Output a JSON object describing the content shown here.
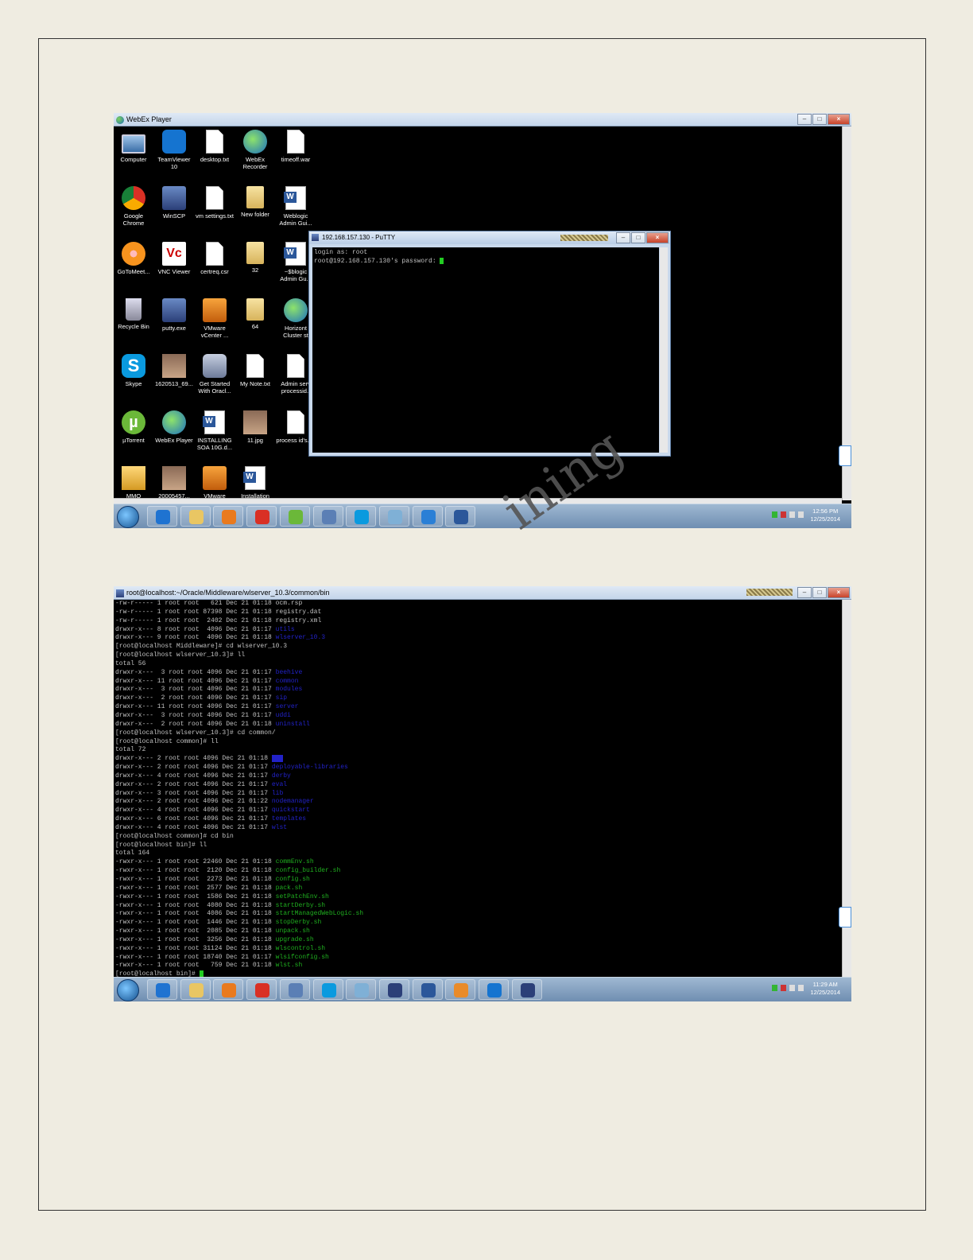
{
  "watermark": "ining",
  "shot1": {
    "window_title": "WebEx Player",
    "desktop_icons": [
      {
        "label": "Computer",
        "icon": "computer-icon",
        "cls": "g-computer"
      },
      {
        "label": "TeamViewer 10",
        "icon": "teamviewer-icon",
        "cls": "g-tv"
      },
      {
        "label": "desktop.txt",
        "icon": "text-file-icon",
        "cls": "g-file"
      },
      {
        "label": "WebEx Recorder",
        "icon": "webex-recorder-icon",
        "cls": "g-webex"
      },
      {
        "label": "timeoff.war",
        "icon": "file-icon",
        "cls": "g-file"
      },
      {
        "label": "Google Chrome",
        "icon": "chrome-icon",
        "cls": "g-chrome"
      },
      {
        "label": "WinSCP",
        "icon": "winscp-icon",
        "cls": "g-putty"
      },
      {
        "label": "vm settings.txt",
        "icon": "text-file-icon",
        "cls": "g-file"
      },
      {
        "label": "New folder",
        "icon": "folder-icon",
        "cls": "g-folder"
      },
      {
        "label": "Weblogic Admin Gui...",
        "icon": "word-doc-icon",
        "cls": "g-word"
      },
      {
        "label": "GoToMeet...",
        "icon": "gotomeeting-icon",
        "cls": "g-gotomeet"
      },
      {
        "label": "VNC Viewer",
        "icon": "vnc-viewer-icon",
        "cls": "g-vnc"
      },
      {
        "label": "certreq.csr",
        "icon": "file-icon",
        "cls": "g-file"
      },
      {
        "label": "32",
        "icon": "folder-icon",
        "cls": "g-folder"
      },
      {
        "label": "~$blogic Admin Gu...",
        "icon": "word-doc-icon",
        "cls": "g-word"
      },
      {
        "label": "Recycle Bin",
        "icon": "recycle-bin-icon",
        "cls": "g-bin"
      },
      {
        "label": "putty.exe",
        "icon": "putty-icon",
        "cls": "g-putty"
      },
      {
        "label": "VMware vCenter ...",
        "icon": "vmware-icon",
        "cls": "g-vmw"
      },
      {
        "label": "64",
        "icon": "folder-icon",
        "cls": "g-folder"
      },
      {
        "label": "Horizont Cluster st",
        "icon": "webex-icon",
        "cls": "g-webex"
      },
      {
        "label": "Skype",
        "icon": "skype-icon",
        "cls": "g-skype"
      },
      {
        "label": "1620513_69...",
        "icon": "photo-icon",
        "cls": "g-photo"
      },
      {
        "label": "Get Started With Oracl...",
        "icon": "database-icon",
        "cls": "g-db"
      },
      {
        "label": "My Note.txt",
        "icon": "text-file-icon",
        "cls": "g-file"
      },
      {
        "label": "Admin serv processid.t",
        "icon": "text-file-icon",
        "cls": "g-file"
      },
      {
        "label": "µTorrent",
        "icon": "utorrent-icon",
        "cls": "g-utorrent"
      },
      {
        "label": "WebEx Player",
        "icon": "webex-player-icon",
        "cls": "g-webex"
      },
      {
        "label": "INSTALLING SOA 10G.d...",
        "icon": "word-doc-icon",
        "cls": "g-word"
      },
      {
        "label": "11.jpg",
        "icon": "photo-icon",
        "cls": "g-photo"
      },
      {
        "label": "process id's.txt",
        "icon": "text-file-icon",
        "cls": "g-file"
      },
      {
        "label": "MMO",
        "icon": "package-icon",
        "cls": "g-pkg"
      },
      {
        "label": "20005457...",
        "icon": "photo-icon",
        "cls": "g-photo"
      },
      {
        "label": "VMware",
        "icon": "vmware-icon",
        "cls": "g-vmw"
      },
      {
        "label": "Installation",
        "icon": "word-doc-icon",
        "cls": "g-word"
      }
    ],
    "putty": {
      "title": "192.168.157.130 - PuTTY",
      "line1": "login as: root",
      "line2": "root@192.168.157.130's password: "
    },
    "clock_time": "12:56 PM",
    "clock_date": "12/25/2014"
  },
  "shot2": {
    "window_title": "root@localhost:~/Oracle/Middleware/wlserver_10.3/common/bin",
    "terminal_lines": [
      {
        "t": "-rw-r----- 1 root root   621 Dec 21 01:18 ocm.rsp"
      },
      {
        "t": "-rw-r----- 1 root root 87398 Dec 21 01:18 registry.dat"
      },
      {
        "t": "-rw-r----- 1 root root  2402 Dec 21 01:18 registry.xml"
      },
      {
        "t": "drwxr-x--- 8 root root  4096 Dec 21 01:17 ",
        "c": "utils",
        "cc": "b"
      },
      {
        "t": "drwxr-x--- 9 root root  4096 Dec 21 01:18 ",
        "c": "wlserver_10.3",
        "cc": "b"
      },
      {
        "t": "[root@localhost Middleware]# cd wlserver_10.3"
      },
      {
        "t": "[root@localhost wlserver_10.3]# ll"
      },
      {
        "t": "total 56"
      },
      {
        "t": "drwxr-x---  3 root root 4096 Dec 21 01:17 ",
        "c": "beehive",
        "cc": "b"
      },
      {
        "t": "drwxr-x--- 11 root root 4096 Dec 21 01:17 ",
        "c": "common",
        "cc": "b"
      },
      {
        "t": "drwxr-x---  3 root root 4096 Dec 21 01:17 ",
        "c": "modules",
        "cc": "b"
      },
      {
        "t": "drwxr-x---  2 root root 4096 Dec 21 01:17 ",
        "c": "sip",
        "cc": "b"
      },
      {
        "t": "drwxr-x--- 11 root root 4096 Dec 21 01:17 ",
        "c": "server",
        "cc": "b"
      },
      {
        "t": "drwxr-x---  3 root root 4096 Dec 21 01:17 ",
        "c": "uddi",
        "cc": "b"
      },
      {
        "t": "drwxr-x---  2 root root 4096 Dec 21 01:18 ",
        "c": "uninstall",
        "cc": "b"
      },
      {
        "t": "[root@localhost wlserver_10.3]# cd common/"
      },
      {
        "t": "[root@localhost common]# ll"
      },
      {
        "t": "total 72"
      },
      {
        "t": "drwxr-x--- 2 root root 4096 Dec 21 01:18 ",
        "c": "bin",
        "cc": "hl"
      },
      {
        "t": "drwxr-x--- 2 root root 4096 Dec 21 01:17 ",
        "c": "deployable-libraries",
        "cc": "b"
      },
      {
        "t": "drwxr-x--- 4 root root 4096 Dec 21 01:17 ",
        "c": "derby",
        "cc": "b"
      },
      {
        "t": "drwxr-x--- 2 root root 4096 Dec 21 01:17 ",
        "c": "eval",
        "cc": "b"
      },
      {
        "t": "drwxr-x--- 3 root root 4096 Dec 21 01:17 ",
        "c": "lib",
        "cc": "b"
      },
      {
        "t": "drwxr-x--- 2 root root 4096 Dec 21 01:22 ",
        "c": "nodemanager",
        "cc": "b"
      },
      {
        "t": "drwxr-x--- 4 root root 4096 Dec 21 01:17 ",
        "c": "quickstart",
        "cc": "b"
      },
      {
        "t": "drwxr-x--- 6 root root 4096 Dec 21 01:17 ",
        "c": "templates",
        "cc": "b"
      },
      {
        "t": "drwxr-x--- 4 root root 4096 Dec 21 01:17 ",
        "c": "wlst",
        "cc": "b"
      },
      {
        "t": "[root@localhost common]# cd bin"
      },
      {
        "t": "[root@localhost bin]# ll"
      },
      {
        "t": "total 164"
      },
      {
        "t": "-rwxr-x--- 1 root root 22460 Dec 21 01:18 ",
        "c": "commEnv.sh",
        "cc": "gr"
      },
      {
        "t": "-rwxr-x--- 1 root root  2120 Dec 21 01:18 ",
        "c": "config_builder.sh",
        "cc": "gr"
      },
      {
        "t": "-rwxr-x--- 1 root root  2273 Dec 21 01:18 ",
        "c": "config.sh",
        "cc": "gr"
      },
      {
        "t": "-rwxr-x--- 1 root root  2577 Dec 21 01:18 ",
        "c": "pack.sh",
        "cc": "gr"
      },
      {
        "t": "-rwxr-x--- 1 root root  1586 Dec 21 01:18 ",
        "c": "setPatchEnv.sh",
        "cc": "gr"
      },
      {
        "t": "-rwxr-x--- 1 root root  4080 Dec 21 01:18 ",
        "c": "startDerby.sh",
        "cc": "gr"
      },
      {
        "t": "-rwxr-x--- 1 root root  4086 Dec 21 01:18 ",
        "c": "startManagedWebLogic.sh",
        "cc": "gr"
      },
      {
        "t": "-rwxr-x--- 1 root root  1446 Dec 21 01:18 ",
        "c": "stopDerby.sh",
        "cc": "gr"
      },
      {
        "t": "-rwxr-x--- 1 root root  2085 Dec 21 01:18 ",
        "c": "unpack.sh",
        "cc": "gr"
      },
      {
        "t": "-rwxr-x--- 1 root root  3256 Dec 21 01:18 ",
        "c": "upgrade.sh",
        "cc": "gr"
      },
      {
        "t": "-rwxr-x--- 1 root root 31124 Dec 21 01:18 ",
        "c": "wlscontrol.sh",
        "cc": "gr"
      },
      {
        "t": "-rwxr-x--- 1 root root 18740 Dec 21 01:17 ",
        "c": "wlsifconfig.sh",
        "cc": "gr"
      },
      {
        "t": "-rwxr-x--- 1 root root   759 Dec 21 01:18 ",
        "c": "wlst.sh",
        "cc": "gr"
      },
      {
        "t": "[root@localhost bin]# ",
        "cursor": true
      }
    ],
    "clock_time": "11:29 AM",
    "clock_date": "12/25/2014"
  },
  "taskbar1": [
    {
      "name": "internet-explorer-icon",
      "color": "#1f73d1"
    },
    {
      "name": "explorer-folder-icon",
      "color": "#e9c663"
    },
    {
      "name": "media-player-icon",
      "color": "#e97a1e"
    },
    {
      "name": "chrome-icon",
      "color": "#d93025"
    },
    {
      "name": "utorrent-icon",
      "color": "#6bb839"
    },
    {
      "name": "network-icon",
      "color": "#5b7fb5"
    },
    {
      "name": "skype-icon",
      "color": "#0a9adf"
    },
    {
      "name": "notes-icon",
      "color": "#7fb0d6"
    },
    {
      "name": "webex-icon",
      "color": "#2a7fd6"
    },
    {
      "name": "word-icon",
      "color": "#2b579a"
    }
  ],
  "taskbar2": [
    {
      "name": "internet-explorer-icon",
      "color": "#1f73d1"
    },
    {
      "name": "explorer-folder-icon",
      "color": "#e9c663"
    },
    {
      "name": "media-player-icon",
      "color": "#e97a1e"
    },
    {
      "name": "chrome-icon",
      "color": "#d93025"
    },
    {
      "name": "network-icon",
      "color": "#5b7fb5"
    },
    {
      "name": "skype-icon",
      "color": "#0a9adf"
    },
    {
      "name": "notes-icon",
      "color": "#7fb0d6"
    },
    {
      "name": "putty-icon",
      "color": "#2b3f78"
    },
    {
      "name": "word-icon",
      "color": "#2b579a"
    },
    {
      "name": "vmware-icon",
      "color": "#e98b2a"
    },
    {
      "name": "teamviewer-icon",
      "color": "#1574d0"
    },
    {
      "name": "putty-icon",
      "color": "#2b3f78"
    }
  ]
}
